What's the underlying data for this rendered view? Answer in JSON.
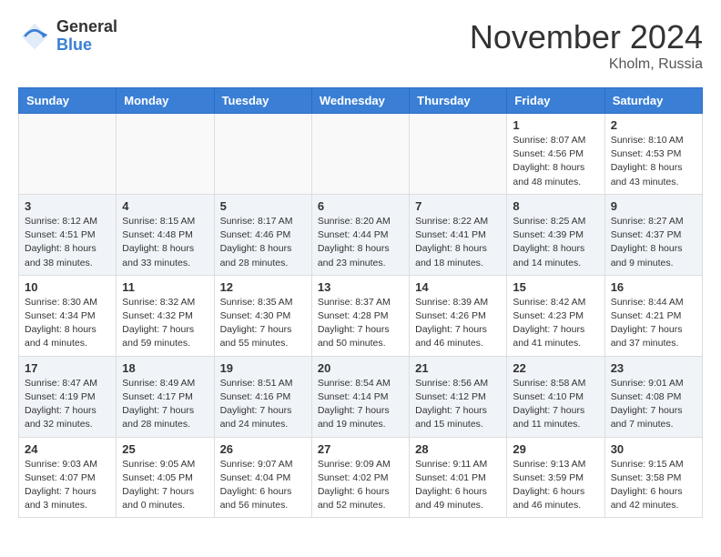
{
  "header": {
    "logo_general": "General",
    "logo_blue": "Blue",
    "month_title": "November 2024",
    "location": "Kholm, Russia"
  },
  "weekdays": [
    "Sunday",
    "Monday",
    "Tuesday",
    "Wednesday",
    "Thursday",
    "Friday",
    "Saturday"
  ],
  "weeks": [
    [
      {
        "day": "",
        "info": ""
      },
      {
        "day": "",
        "info": ""
      },
      {
        "day": "",
        "info": ""
      },
      {
        "day": "",
        "info": ""
      },
      {
        "day": "",
        "info": ""
      },
      {
        "day": "1",
        "info": "Sunrise: 8:07 AM\nSunset: 4:56 PM\nDaylight: 8 hours\nand 48 minutes."
      },
      {
        "day": "2",
        "info": "Sunrise: 8:10 AM\nSunset: 4:53 PM\nDaylight: 8 hours\nand 43 minutes."
      }
    ],
    [
      {
        "day": "3",
        "info": "Sunrise: 8:12 AM\nSunset: 4:51 PM\nDaylight: 8 hours\nand 38 minutes."
      },
      {
        "day": "4",
        "info": "Sunrise: 8:15 AM\nSunset: 4:48 PM\nDaylight: 8 hours\nand 33 minutes."
      },
      {
        "day": "5",
        "info": "Sunrise: 8:17 AM\nSunset: 4:46 PM\nDaylight: 8 hours\nand 28 minutes."
      },
      {
        "day": "6",
        "info": "Sunrise: 8:20 AM\nSunset: 4:44 PM\nDaylight: 8 hours\nand 23 minutes."
      },
      {
        "day": "7",
        "info": "Sunrise: 8:22 AM\nSunset: 4:41 PM\nDaylight: 8 hours\nand 18 minutes."
      },
      {
        "day": "8",
        "info": "Sunrise: 8:25 AM\nSunset: 4:39 PM\nDaylight: 8 hours\nand 14 minutes."
      },
      {
        "day": "9",
        "info": "Sunrise: 8:27 AM\nSunset: 4:37 PM\nDaylight: 8 hours\nand 9 minutes."
      }
    ],
    [
      {
        "day": "10",
        "info": "Sunrise: 8:30 AM\nSunset: 4:34 PM\nDaylight: 8 hours\nand 4 minutes."
      },
      {
        "day": "11",
        "info": "Sunrise: 8:32 AM\nSunset: 4:32 PM\nDaylight: 7 hours\nand 59 minutes."
      },
      {
        "day": "12",
        "info": "Sunrise: 8:35 AM\nSunset: 4:30 PM\nDaylight: 7 hours\nand 55 minutes."
      },
      {
        "day": "13",
        "info": "Sunrise: 8:37 AM\nSunset: 4:28 PM\nDaylight: 7 hours\nand 50 minutes."
      },
      {
        "day": "14",
        "info": "Sunrise: 8:39 AM\nSunset: 4:26 PM\nDaylight: 7 hours\nand 46 minutes."
      },
      {
        "day": "15",
        "info": "Sunrise: 8:42 AM\nSunset: 4:23 PM\nDaylight: 7 hours\nand 41 minutes."
      },
      {
        "day": "16",
        "info": "Sunrise: 8:44 AM\nSunset: 4:21 PM\nDaylight: 7 hours\nand 37 minutes."
      }
    ],
    [
      {
        "day": "17",
        "info": "Sunrise: 8:47 AM\nSunset: 4:19 PM\nDaylight: 7 hours\nand 32 minutes."
      },
      {
        "day": "18",
        "info": "Sunrise: 8:49 AM\nSunset: 4:17 PM\nDaylight: 7 hours\nand 28 minutes."
      },
      {
        "day": "19",
        "info": "Sunrise: 8:51 AM\nSunset: 4:16 PM\nDaylight: 7 hours\nand 24 minutes."
      },
      {
        "day": "20",
        "info": "Sunrise: 8:54 AM\nSunset: 4:14 PM\nDaylight: 7 hours\nand 19 minutes."
      },
      {
        "day": "21",
        "info": "Sunrise: 8:56 AM\nSunset: 4:12 PM\nDaylight: 7 hours\nand 15 minutes."
      },
      {
        "day": "22",
        "info": "Sunrise: 8:58 AM\nSunset: 4:10 PM\nDaylight: 7 hours\nand 11 minutes."
      },
      {
        "day": "23",
        "info": "Sunrise: 9:01 AM\nSunset: 4:08 PM\nDaylight: 7 hours\nand 7 minutes."
      }
    ],
    [
      {
        "day": "24",
        "info": "Sunrise: 9:03 AM\nSunset: 4:07 PM\nDaylight: 7 hours\nand 3 minutes."
      },
      {
        "day": "25",
        "info": "Sunrise: 9:05 AM\nSunset: 4:05 PM\nDaylight: 7 hours\nand 0 minutes."
      },
      {
        "day": "26",
        "info": "Sunrise: 9:07 AM\nSunset: 4:04 PM\nDaylight: 6 hours\nand 56 minutes."
      },
      {
        "day": "27",
        "info": "Sunrise: 9:09 AM\nSunset: 4:02 PM\nDaylight: 6 hours\nand 52 minutes."
      },
      {
        "day": "28",
        "info": "Sunrise: 9:11 AM\nSunset: 4:01 PM\nDaylight: 6 hours\nand 49 minutes."
      },
      {
        "day": "29",
        "info": "Sunrise: 9:13 AM\nSunset: 3:59 PM\nDaylight: 6 hours\nand 46 minutes."
      },
      {
        "day": "30",
        "info": "Sunrise: 9:15 AM\nSunset: 3:58 PM\nDaylight: 6 hours\nand 42 minutes."
      }
    ]
  ]
}
